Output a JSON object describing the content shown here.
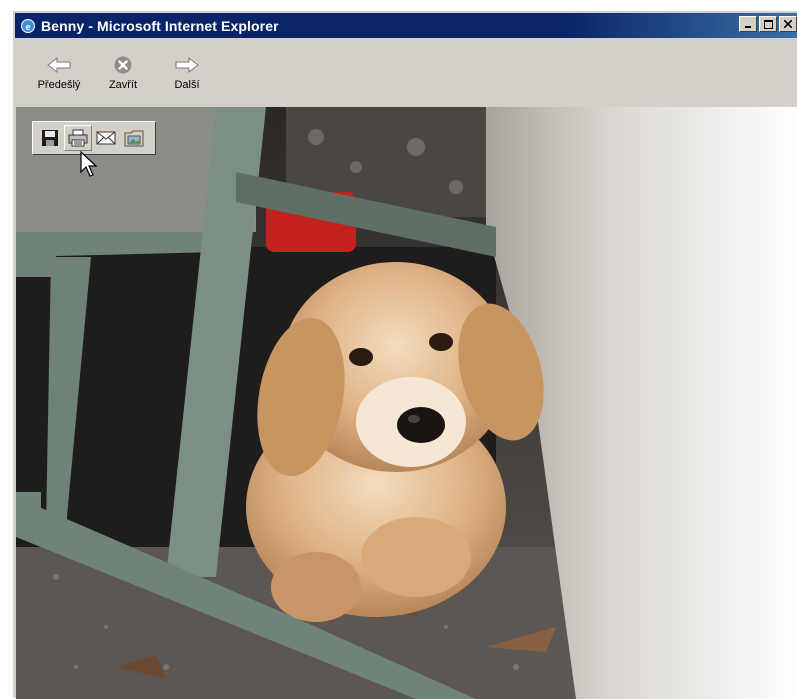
{
  "window": {
    "title": "Benny - Microsoft Internet Explorer",
    "buttons": [
      "minimize",
      "maximize",
      "close"
    ]
  },
  "toolbar": {
    "items": [
      {
        "label": "Předešlý",
        "icon": "arrow-left-icon"
      },
      {
        "label": "Zavřít",
        "icon": "close-circle-icon"
      },
      {
        "label": "Další",
        "icon": "arrow-right-icon"
      }
    ]
  },
  "image_toolbar": {
    "items": [
      {
        "icon": "save-icon"
      },
      {
        "icon": "print-icon",
        "state": "hover"
      },
      {
        "icon": "email-icon"
      },
      {
        "icon": "my-pictures-icon"
      }
    ]
  },
  "colors": {
    "titlebar": "#0a246a",
    "chrome": "#d4d0c8"
  }
}
